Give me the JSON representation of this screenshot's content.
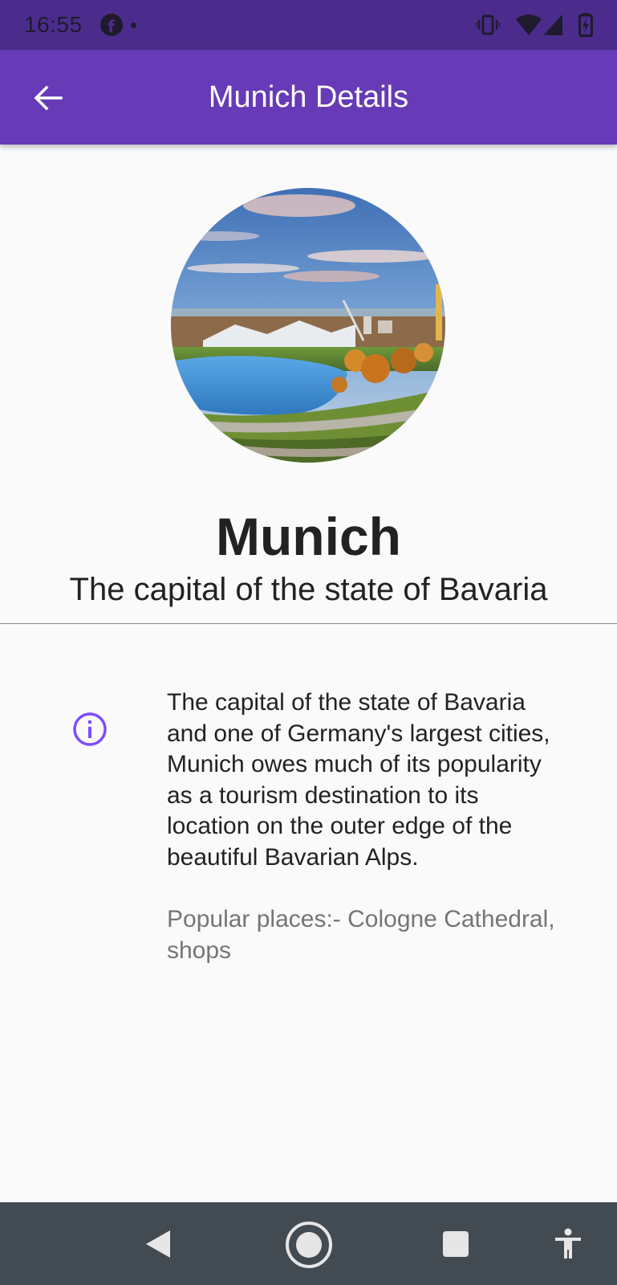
{
  "status_bar": {
    "time": "16:55",
    "icons": [
      "facebook-icon",
      "notification-dot",
      "vibrate-icon",
      "wifi-icon",
      "signal-icon",
      "battery-icon"
    ]
  },
  "app_bar": {
    "title": "Munich Details",
    "back_icon": "arrow-back-icon"
  },
  "city": {
    "name": "Munich",
    "subtitle": "The capital of the state of Bavaria",
    "description": "The capital of the state of Bavaria and one of Germany's largest cities, Munich owes much of its popularity as a tourism destination to its location on the outer edge of the beautiful Bavarian Alps.",
    "popular_places": "Popular places:- Cologne Cathedral, shops",
    "info_icon": "info-icon"
  },
  "colors": {
    "status_bar": "#4b2c8c",
    "app_bar": "#673ab7",
    "accent": "#7c4dff",
    "nav_bar": "#434b52",
    "background": "#fafafa"
  },
  "nav_bar": {
    "buttons": [
      "back-triangle-icon",
      "home-circle-icon",
      "recents-square-icon",
      "accessibility-icon"
    ]
  }
}
